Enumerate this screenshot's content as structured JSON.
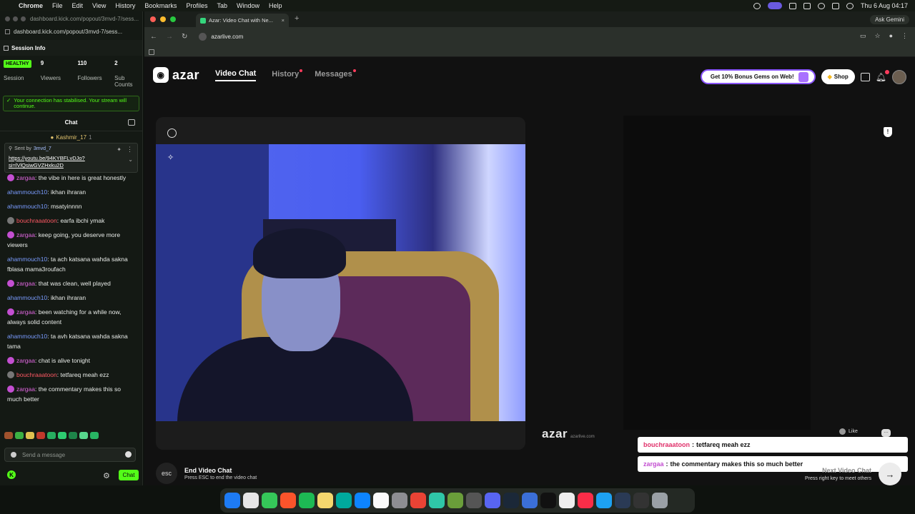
{
  "menubar": {
    "app": "Chrome",
    "items": [
      "File",
      "Edit",
      "View",
      "History",
      "Bookmarks",
      "Profiles",
      "Tab",
      "Window",
      "Help"
    ],
    "clock": "Thu 6 Aug  04:17"
  },
  "kick": {
    "title_url": "dashboard.kick.com/popout/3mvd-7/sess...",
    "url": "dashboard.kick.com/popout/3mvd-7/sess...",
    "session_title": "Session Info",
    "stats": [
      {
        "value": "HEALTHY",
        "label": "Session"
      },
      {
        "value": "9",
        "label": "Viewers"
      },
      {
        "value": "110",
        "label": "Followers"
      },
      {
        "value": "2",
        "label": "Sub Counts"
      }
    ],
    "stable_msg": "Your connection has stabilised. Your stream will continue.",
    "chat_title": "Chat",
    "pinned_user": "Kashmir_17",
    "pinned_count": "1",
    "pinned_sent_by": "Sent by",
    "pinned_sender": "3mvd_7",
    "pinned_link": "https://youtu.be/94KYBFLvDJo?si=lVlQsiwGVZHxku2D",
    "messages": [
      {
        "user": "zargaa",
        "text": "the vibe in here is great honestly",
        "cls": "u1"
      },
      {
        "user": "ahammouch10",
        "text": "ikhan ihraran",
        "cls": "u2"
      },
      {
        "user": "ahammouch10",
        "text": "msatyinnnn",
        "cls": "u2"
      },
      {
        "user": "bouchraaatoon",
        "text": "earfa ibchi ymak",
        "cls": "u3"
      },
      {
        "user": "zargaa",
        "text": "keep going, you deserve more viewers",
        "cls": "u1"
      },
      {
        "user": "ahammouch10",
        "text": "ta ach katsana wahda sakna fblasa mama3roufach",
        "cls": "u2"
      },
      {
        "user": "zargaa",
        "text": "that was clean, well played",
        "cls": "u1"
      },
      {
        "user": "ahammouch10",
        "text": "ikhan ihraran",
        "cls": "u2"
      },
      {
        "user": "zargaa",
        "text": "been watching for a while now, always solid content",
        "cls": "u1"
      },
      {
        "user": "ahammouch10",
        "text": "ta avh katsana wahda sakna tama",
        "cls": "u2"
      },
      {
        "user": "zargaa",
        "text": "chat is alive tonight",
        "cls": "u1"
      },
      {
        "user": "bouchraaatoon",
        "text": "tetfareq meah ezz",
        "cls": "u3"
      },
      {
        "user": "zargaa",
        "text": "the commentary makes this so much better",
        "cls": "u1"
      }
    ],
    "send_placeholder": "Send a message",
    "chat_button": "Chat"
  },
  "chrome": {
    "tab_title": "Azar: Video Chat with Ne...",
    "address": "azarlive.com",
    "gemini": "Ask Gemini"
  },
  "azar": {
    "logo": "azar",
    "nav": [
      "Video Chat",
      "History",
      "Messages"
    ],
    "gems_cta": "Get 10% Bonus Gems on Web!",
    "shop": "Shop",
    "end_key": "esc",
    "end_title": "End Video Chat",
    "end_sub": "Press ESC to end the video chat",
    "watermark": "azar",
    "watermark_id": "azarlive.com",
    "like_label": "Like",
    "overlay_chat": [
      {
        "user": "bouchraaatoon",
        "text": "tetfareq meah ezz",
        "color": "#e0306a"
      },
      {
        "user": "zargaa",
        "text": "the commentary makes this so much better",
        "color": "#c34fd1"
      }
    ],
    "next_title": "Next Video Chat",
    "next_sub": "Press right key to meet others"
  },
  "colors": {
    "kick_green": "#53fc18",
    "azar_bg": "#111111"
  }
}
